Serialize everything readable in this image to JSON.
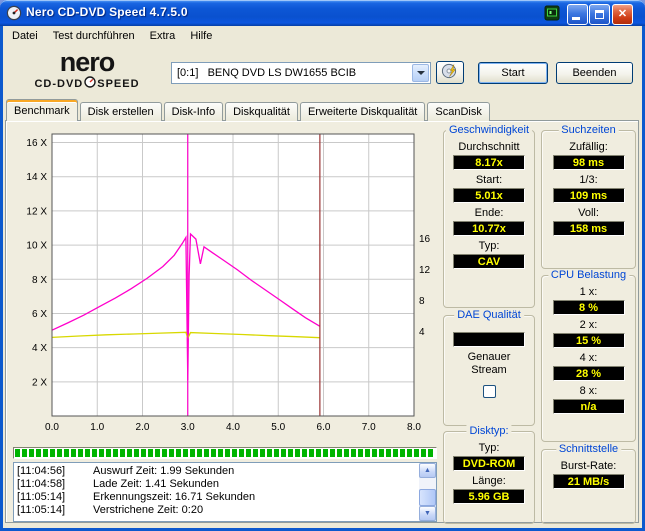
{
  "window": {
    "title": "Nero CD-DVD Speed 4.7.5.0"
  },
  "menubar": {
    "items": [
      {
        "id": "datei",
        "label": "Datei"
      },
      {
        "id": "test-durchfuehren",
        "label": "Test durchführen"
      },
      {
        "id": "extra",
        "label": "Extra"
      },
      {
        "id": "hilfe",
        "label": "Hilfe"
      }
    ]
  },
  "logo": {
    "name": "nero",
    "product_left": "CD-DVD",
    "product_right": "SPEED"
  },
  "toolbar": {
    "drive_selector": "[0:1]   BENQ DVD LS DW1655 BCIB",
    "start_button": "Start",
    "quit_button": "Beenden"
  },
  "tabs": {
    "items": [
      {
        "id": "benchmark",
        "label": "Benchmark",
        "active": true
      },
      {
        "id": "disk-erstellen",
        "label": "Disk erstellen",
        "active": false
      },
      {
        "id": "disk-info",
        "label": "Disk-Info",
        "active": false
      },
      {
        "id": "diskqualitaet",
        "label": "Diskqualität",
        "active": false
      },
      {
        "id": "erweiterte-diskqualitaet",
        "label": "Erweiterte Diskqualität",
        "active": false
      },
      {
        "id": "scandisk",
        "label": "ScanDisk",
        "active": false
      }
    ]
  },
  "chart_data": {
    "type": "line",
    "title": "",
    "xlabel": "",
    "ylabel": "",
    "x_axis": {
      "min": 0,
      "max": 8,
      "ticks": [
        "0.0",
        "1.0",
        "2.0",
        "3.0",
        "4.0",
        "5.0",
        "6.0",
        "7.0",
        "8.0"
      ]
    },
    "y_axis_left": {
      "min": 0,
      "max": 16.5,
      "ticks": [
        {
          "v": 16,
          "label": "16 X"
        },
        {
          "v": 14,
          "label": "14 X"
        },
        {
          "v": 12,
          "label": "12 X"
        },
        {
          "v": 10,
          "label": "10 X"
        },
        {
          "v": 8,
          "label": "8 X"
        },
        {
          "v": 6,
          "label": "6 X"
        },
        {
          "v": 4,
          "label": "4 X"
        },
        {
          "v": 2,
          "label": "2 X"
        }
      ]
    },
    "y_axis_right": {
      "ticks": [
        {
          "label": "16",
          "frac": 0.37
        },
        {
          "label": "12",
          "frac": 0.48
        },
        {
          "label": "8",
          "frac": 0.59
        },
        {
          "label": "4",
          "frac": 0.7
        }
      ]
    },
    "grid": {
      "x_step": 1,
      "y_step": 2
    },
    "series": [
      {
        "name": "read-speed",
        "color": "#FF00CC",
        "points": [
          [
            0,
            5.02
          ],
          [
            0.35,
            5.45
          ],
          [
            0.7,
            5.9
          ],
          [
            1.05,
            6.4
          ],
          [
            1.4,
            6.9
          ],
          [
            1.75,
            7.45
          ],
          [
            2.1,
            8.05
          ],
          [
            2.45,
            8.75
          ],
          [
            2.7,
            9.4
          ],
          [
            2.88,
            10.1
          ],
          [
            2.96,
            10.45
          ],
          [
            3.0,
            2.1
          ],
          [
            3.03,
            8.2
          ],
          [
            3.06,
            10.65
          ],
          [
            3.18,
            10.35
          ],
          [
            3.28,
            8.9
          ],
          [
            3.36,
            9.9
          ],
          [
            3.55,
            9.55
          ],
          [
            3.8,
            9.1
          ],
          [
            4.1,
            8.55
          ],
          [
            4.4,
            7.95
          ],
          [
            4.7,
            7.4
          ],
          [
            5.0,
            6.85
          ],
          [
            5.3,
            6.3
          ],
          [
            5.6,
            5.75
          ],
          [
            5.92,
            5.25
          ]
        ]
      },
      {
        "name": "rotation-speed",
        "color": "#D8D800",
        "points": [
          [
            0,
            4.6
          ],
          [
            0.6,
            4.68
          ],
          [
            1.2,
            4.75
          ],
          [
            1.8,
            4.8
          ],
          [
            2.4,
            4.85
          ],
          [
            2.96,
            4.9
          ],
          [
            3.0,
            4.55
          ],
          [
            3.06,
            4.88
          ],
          [
            3.6,
            4.83
          ],
          [
            4.2,
            4.77
          ],
          [
            4.8,
            4.7
          ],
          [
            5.4,
            4.64
          ],
          [
            5.92,
            4.58
          ]
        ]
      }
    ],
    "markers": [
      {
        "name": "layer-break-marker",
        "x": 3.0,
        "color": "#FF00CC"
      },
      {
        "name": "end-of-disc-marker",
        "x": 5.92,
        "color": "#9A3333"
      }
    ]
  },
  "panels": {
    "speed": {
      "title": "Geschwindigkeit",
      "fields": [
        {
          "label": "Durchschnitt",
          "value": "8.17x"
        },
        {
          "label": "Start:",
          "value": "5.01x"
        },
        {
          "label": "Ende:",
          "value": "10.77x"
        },
        {
          "label": "Typ:",
          "value": "CAV"
        }
      ]
    },
    "seek": {
      "title": "Suchzeiten",
      "fields": [
        {
          "label": "Zufällig:",
          "value": "98 ms"
        },
        {
          "label": "1/3:",
          "value": "109 ms"
        },
        {
          "label": "Voll:",
          "value": "158 ms"
        }
      ]
    },
    "cpu": {
      "title": "CPU Belastung",
      "fields": [
        {
          "label": "1 x:",
          "value": "8 %"
        },
        {
          "label": "2 x:",
          "value": "15 %"
        },
        {
          "label": "4 x:",
          "value": "28 %"
        },
        {
          "label": "8 x:",
          "value": "n/a"
        }
      ]
    },
    "dae": {
      "title": "DAE Qualität",
      "value": "",
      "option_line1": "Genauer",
      "option_line2": "Stream",
      "checkbox_checked": false
    },
    "disc": {
      "title": "Disktyp:",
      "fields": [
        {
          "label": "Typ:",
          "value": "DVD-ROM"
        },
        {
          "label": "Länge:",
          "value": "5.96 GB"
        }
      ]
    },
    "interface": {
      "title": "Schnittstelle",
      "fields": [
        {
          "label": "Burst-Rate:",
          "value": "21 MB/s"
        }
      ]
    }
  },
  "log": {
    "entries": [
      {
        "time": "[11:04:56]",
        "text": "Auswurf Zeit: 1.99 Sekunden"
      },
      {
        "time": "[11:04:58]",
        "text": "Lade Zeit: 1.41 Sekunden"
      },
      {
        "time": "[11:05:14]",
        "text": "Erkennungszeit: 16.71 Sekunden"
      },
      {
        "time": "[11:05:14]",
        "text": "Verstrichene Zeit: 0:20"
      }
    ]
  },
  "colors": {
    "title_bar": "#0A51CF",
    "window_bg": "#ECE9D8",
    "value_bg": "#000000",
    "value_text": "#FFFF00",
    "caption_text": "#0046D5",
    "speed_line": "#FF00CC",
    "rpm_line": "#D8D800",
    "end_line": "#9A3333",
    "progress": "#00B400"
  }
}
